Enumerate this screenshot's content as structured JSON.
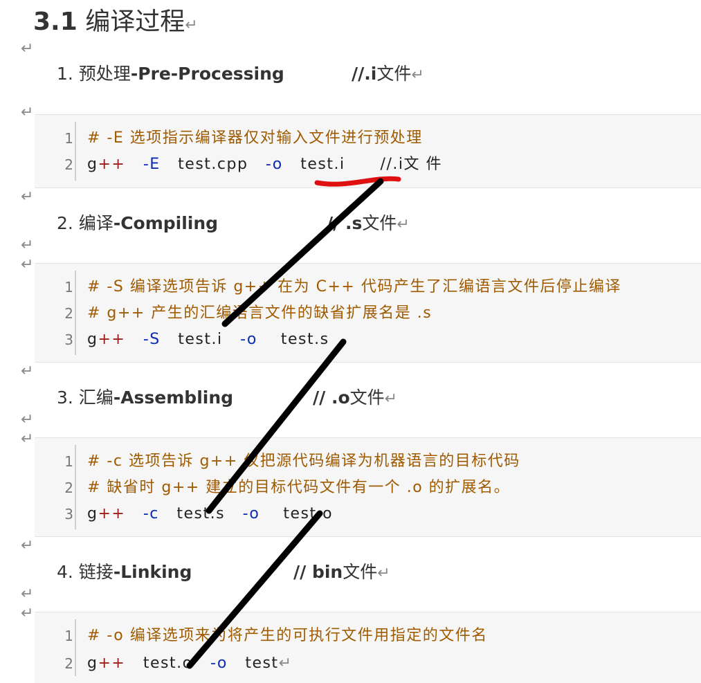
{
  "title": {
    "number": "3.1",
    "text": "编译过程"
  },
  "return_mark": "↵",
  "sections": [
    {
      "heading_prefix": "1. 预处理",
      "heading_bold": "-Pre-Processing",
      "note_bold": "//.i",
      "note_rest": "文件",
      "code": [
        {
          "num": "1",
          "comment": "# -E 选项指示编译器仅对输入文件进行预处理"
        },
        {
          "num": "2",
          "tokens": [
            "g",
            "++",
            "-E",
            "test.cpp",
            "-o",
            "test.i",
            "//.i文 件"
          ]
        }
      ]
    },
    {
      "heading_prefix": "2. 编译",
      "heading_bold": "-Compiling",
      "note_bold": "// .s",
      "note_rest": "文件",
      "code": [
        {
          "num": "1",
          "comment": "# -S 编译选项告诉 g++ 在为 C++ 代码产生了汇编语言文件后停止编译"
        },
        {
          "num": "2",
          "comment": "#  g++ 产生的汇编语言文件的缺省扩展名是 .s"
        },
        {
          "num": "3",
          "tokens": [
            "g",
            "++",
            "-S",
            "test.i",
            "-o",
            "test.s"
          ]
        }
      ]
    },
    {
      "heading_prefix": "3. 汇编",
      "heading_bold": "-Assembling",
      "note_bold": "// .o",
      "note_rest": "文件",
      "code": [
        {
          "num": "1",
          "comment": "# -c 选项告诉 g++ 仅把源代码编译为机器语言的目标代码"
        },
        {
          "num": "2",
          "comment": "# 缺省时 g++ 建立的目标代码文件有一个 .o 的扩展名。"
        },
        {
          "num": "3",
          "tokens": [
            "g",
            "++",
            "-c",
            "test.s",
            "-o",
            "test.o"
          ]
        }
      ]
    },
    {
      "heading_prefix": "4. 链接",
      "heading_bold": "-Linking",
      "note_bold": "// bin",
      "note_rest": "文件",
      "code": [
        {
          "num": "1",
          "comment": "# -o 编译选项来为将产生的可执行文件用指定的文件名"
        },
        {
          "num": "2",
          "tokens": [
            "g",
            "++",
            "test.o",
            "-o",
            "test"
          ]
        }
      ]
    }
  ],
  "annotation_colors": {
    "underline": "#e01010",
    "arrows": "#000000"
  }
}
